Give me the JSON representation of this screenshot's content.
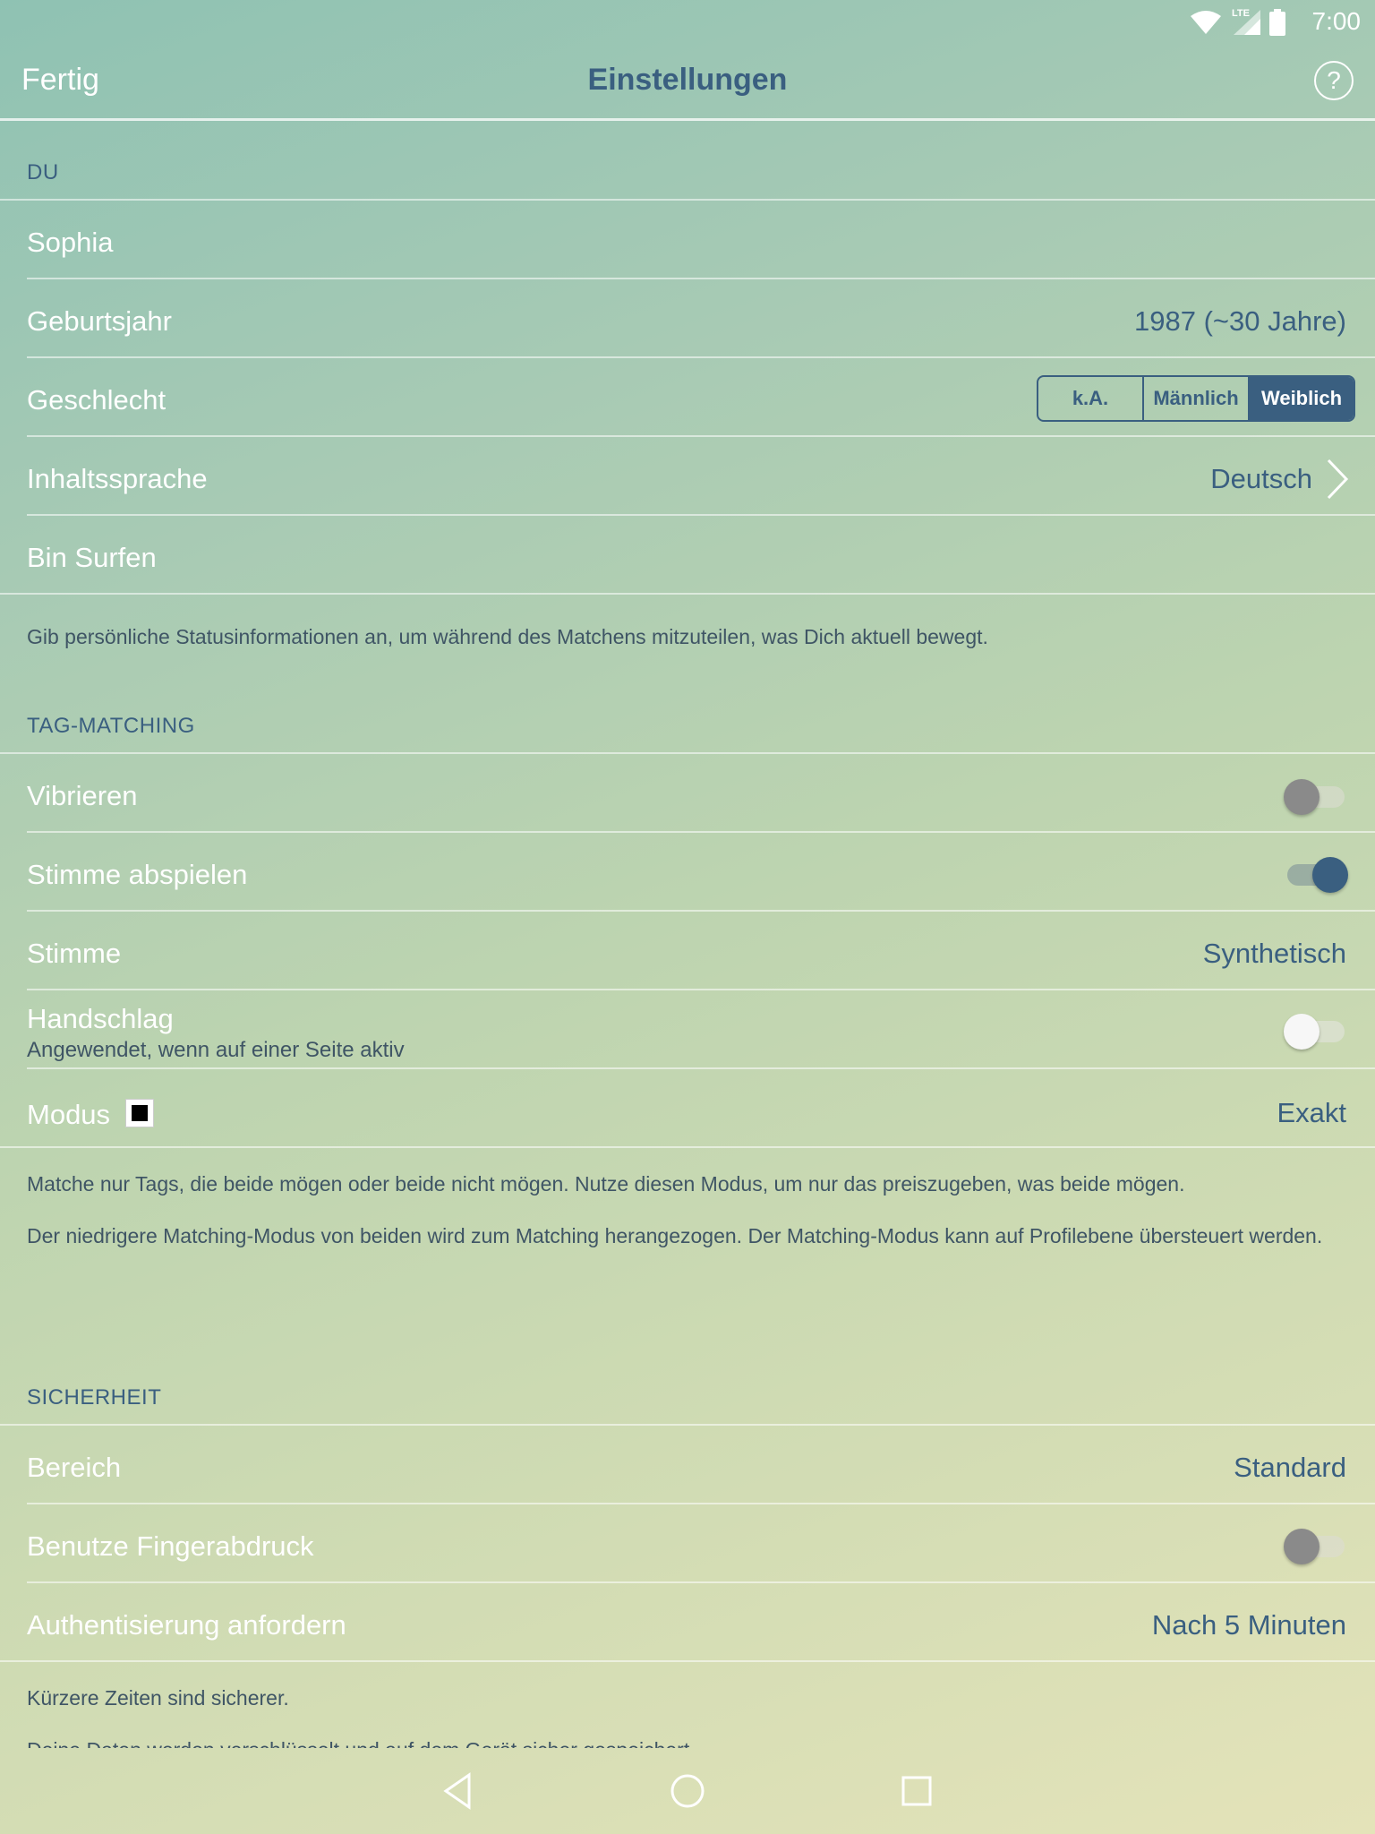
{
  "status_bar": {
    "time": "7:00",
    "network": "LTE"
  },
  "header": {
    "done_label": "Fertig",
    "title": "Einstellungen",
    "help_symbol": "?"
  },
  "section_du": {
    "heading": "DU",
    "name": "Sophia",
    "birth_year_label": "Geburtsjahr",
    "birth_year_value": "1987 (~30 Jahre)",
    "gender_label": "Geschlecht",
    "gender_options": [
      "k.A.",
      "Männlich",
      "Weiblich"
    ],
    "gender_selected": "Weiblich",
    "language_label": "Inhaltssprache",
    "language_value": "Deutsch",
    "status_label": "Bin Surfen",
    "status_note": "Gib persönliche Statusinformationen an, um während des Matchens mitzuteilen, was Dich aktuell bewegt."
  },
  "section_tag": {
    "heading": "TAG-MATCHING",
    "vibrate_label": "Vibrieren",
    "vibrate_on": false,
    "voice_play_label": "Stimme abspielen",
    "voice_play_on": true,
    "voice_label": "Stimme",
    "voice_value": "Synthetisch",
    "handshake_label": "Handschlag",
    "handshake_sub": "Angewendet, wenn auf einer Seite aktiv",
    "handshake_on": false,
    "mode_label": "Modus",
    "mode_value": "Exakt",
    "mode_note_1": "Matche nur Tags, die beide mögen oder beide nicht mögen. Nutze diesen Modus, um nur das preiszugeben, was beide mögen.",
    "mode_note_2": "Der niedrigere Matching-Modus von beiden wird zum Matching herangezogen. Der Matching-Modus kann auf Profilebene übersteuert werden."
  },
  "section_security": {
    "heading": "SICHERHEIT",
    "area_label": "Bereich",
    "area_value": "Standard",
    "fingerprint_label": "Benutze Fingerabdruck",
    "fingerprint_on": false,
    "auth_label": "Authentisierung anfordern",
    "auth_value": "Nach 5 Minuten",
    "note_1": "Kürzere Zeiten sind sicherer.",
    "note_2": "Deine Daten werden verschlüsselt und auf dem Gerät sicher gespeichert."
  },
  "colors": {
    "accent": "#3a5f80"
  }
}
